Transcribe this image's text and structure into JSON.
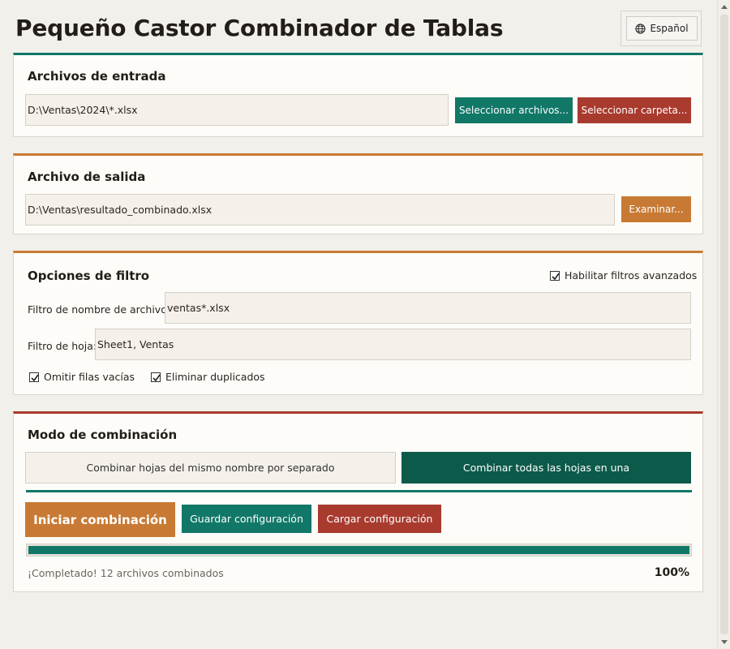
{
  "app": {
    "title": "Pequeño Castor Combinador de Tablas",
    "language_label": "Español"
  },
  "input_section": {
    "title": "Archivos de entrada",
    "path_value": "D:\\Ventas\\2024\\*.xlsx",
    "select_files_label": "Seleccionar archivos...",
    "select_folder_label": "Seleccionar carpeta..."
  },
  "output_section": {
    "title": "Archivo de salida",
    "path_value": "D:\\Ventas\\resultado_combinado.xlsx",
    "browse_label": "Examinar..."
  },
  "filter_section": {
    "title": "Opciones de filtro",
    "advanced_filters_label": "Habilitar filtros avanzados",
    "advanced_filters_checked": true,
    "filename_filter_label": "Filtro de nombre de archivo:",
    "filename_filter_value": "ventas*.xlsx",
    "sheet_filter_label": "Filtro de hoja:",
    "sheet_filter_value": "Sheet1, Ventas",
    "skip_empty_rows_label": "Omitir filas vacías",
    "skip_empty_rows_checked": true,
    "remove_duplicates_label": "Eliminar duplicados",
    "remove_duplicates_checked": true
  },
  "merge_section": {
    "title": "Modo de combinación",
    "mode_separate_label": "Combinar hojas del mismo nombre por separado",
    "mode_all_label": "Combinar todas las hojas en una",
    "selected_mode": "all",
    "start_label": "Iniciar combinación",
    "save_config_label": "Guardar configuración",
    "load_config_label": "Cargar configuración",
    "progress_percent": 100,
    "progress_text": "100%",
    "status_text": "¡Completado! 12 archivos combinados"
  },
  "colors": {
    "teal": "#117868",
    "dark_teal": "#0c5a4a",
    "orange": "#c87a34",
    "red": "#a93a2e",
    "background": "#f2f0eb",
    "panel": "#fdfcf8"
  }
}
